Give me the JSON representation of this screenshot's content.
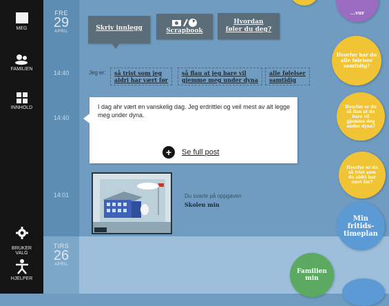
{
  "sidebar": {
    "items": [
      {
        "label": "MEG",
        "icon": "square-icon"
      },
      {
        "label": "FAMILIEN",
        "icon": "family-icon"
      },
      {
        "label": "INNHOLD",
        "icon": "grid-icon"
      },
      {
        "label": "BRUKER\nVALG",
        "icon": "gear-icon"
      },
      {
        "label": "HJELPER",
        "icon": "person-icon"
      }
    ]
  },
  "days": [
    {
      "name": "FRE",
      "date": "29",
      "month": "APRIL"
    },
    {
      "name": "TIRS",
      "date": "26",
      "month": "APRIL"
    }
  ],
  "times": [
    "14:40",
    "14:40",
    "14:01"
  ],
  "actions": {
    "write_post": "Skriv innlegg",
    "scrapbook": "Scrapbook",
    "how_feel_1": "Hvordan",
    "how_feel_2": "føler du deg?"
  },
  "mood": {
    "prefix": "Jeg er:",
    "options": [
      [
        "så trist som jeg",
        "aldri har vært før"
      ],
      [
        "så flau at jeg bare vil",
        "gjemme meg under dyna"
      ],
      [
        "alle følelser",
        "samtidig"
      ]
    ]
  },
  "post": {
    "text": "I dag ahr vært en vanskelig dag. Jeg erdrittlei og veil mest av alt legge meg under dyna.",
    "see_full": "Se full post"
  },
  "task": {
    "intro": "Du svarte på oppgaven",
    "title": "Skolen min"
  },
  "bubbles": {
    "purple_top": "...vur",
    "yellow1": [
      "Hvorfor har du",
      "alle følelser",
      "samtidig?"
    ],
    "yellow2": [
      "Hvorfor er du",
      "så flau at du",
      "bare vil",
      "gjemme deg",
      "under dyna?"
    ],
    "yellow3": [
      "Hvorfor er du",
      "så trist som",
      "du aldri har",
      "vært før?"
    ],
    "blue": [
      "Min",
      "fritids-",
      "timeplan"
    ],
    "green": [
      "Familien",
      "min"
    ]
  },
  "colors": {
    "sidebar": "#141414",
    "bubble_yellow": "#f1c436",
    "bubble_blue": "#5c9ad6",
    "bubble_green": "#5caa62",
    "bubble_purple": "#9a6cc2"
  }
}
